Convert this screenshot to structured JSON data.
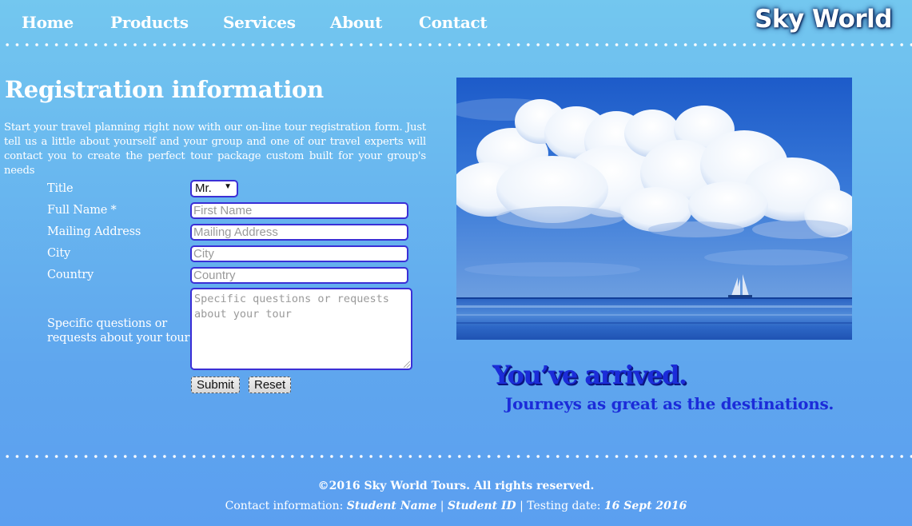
{
  "nav": {
    "items": [
      {
        "label": "Home"
      },
      {
        "label": "Products"
      },
      {
        "label": "Services"
      },
      {
        "label": "About"
      },
      {
        "label": "Contact"
      }
    ],
    "brand": "Sky World"
  },
  "registration": {
    "title": "Registration information",
    "intro": "Start your travel planning right now with our on-line tour registration form. Just tell us a little about yourself and your group and one of our travel experts will contact you to create the perfect tour package custom built for your group's needs",
    "fields": {
      "title_label": "Title",
      "title_value": "Mr.",
      "fullname_label": "Full Name *",
      "fullname_placeholder": "First Name",
      "address_label": "Mailing Address",
      "address_placeholder": "Mailing Address",
      "city_label": "City",
      "city_placeholder": "City",
      "country_label": "Country",
      "country_placeholder": "Country",
      "questions_label_line1": "Specific questions or",
      "questions_label_line2": "requests about your tour",
      "questions_placeholder": "Specific questions or requests about your tour"
    },
    "buttons": {
      "submit": "Submit",
      "reset": "Reset"
    }
  },
  "hero": {
    "tagline": "You’ve arrived.",
    "subtagline": "Journeys as great as the destinations."
  },
  "footer": {
    "copyright": "©2016 Sky World Tours. All rights reserved.",
    "contact_prefix": "Contact information: ",
    "student_name": "Student Name",
    "separator": " | ",
    "student_id": "Student ID",
    "testing_prefix": " | Testing date: ",
    "testing_date": "16 Sept 2016"
  },
  "colors": {
    "accent_blue": "#1b2cd9",
    "input_border": "#3b2fd6",
    "background_top": "#73c7ef",
    "background_bottom": "#5b9ff0"
  },
  "icons": {
    "select_arrow": "caret-down-icon"
  }
}
